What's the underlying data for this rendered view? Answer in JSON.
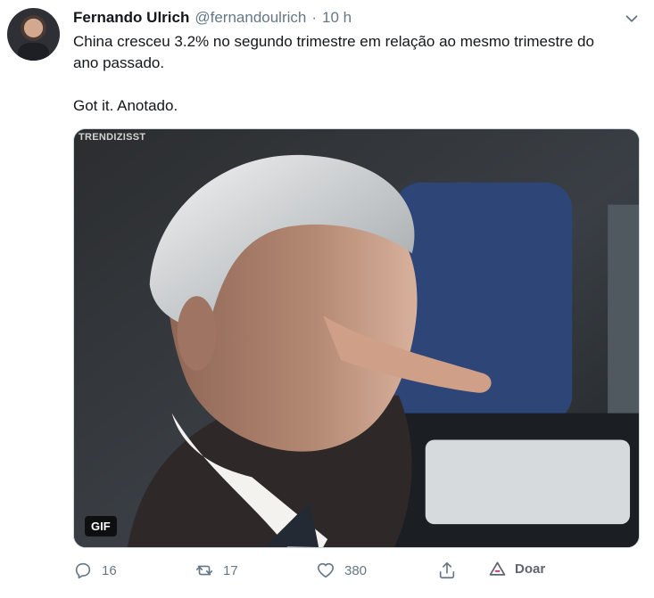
{
  "tweet": {
    "name": "Fernando Ulrich",
    "handle": "@fernandoulrich",
    "separator": "·",
    "time": "10 h",
    "text_lines": [
      "China cresceu 3.2% no segundo trimestre em relação ao mesmo trimestre do",
      "ano passado."
    ],
    "text_followup": "Got it. Anotado.",
    "media": {
      "watermark": "TRENDIZISST",
      "badge": "GIF"
    },
    "actions": {
      "reply_count": "16",
      "retweet_count": "17",
      "like_count": "380",
      "donate_label": "Doar"
    },
    "icons": {
      "caret": "chevron-down-icon",
      "reply": "comment-icon",
      "retweet": "retweet-icon",
      "like": "heart-icon",
      "share": "share-icon",
      "donate": "donate-triangle-icon"
    },
    "colors": {
      "text": "#14171a",
      "muted": "#657786",
      "border": "#ccd6dd",
      "donate": "#5e6470"
    }
  }
}
